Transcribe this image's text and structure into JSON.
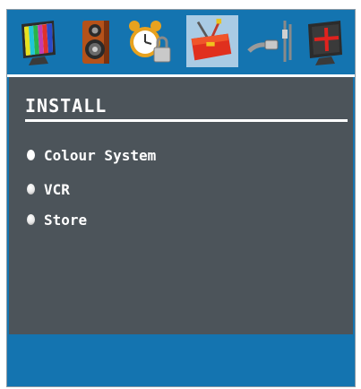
{
  "menu": {
    "title": "INSTALL",
    "items": [
      {
        "label": "Colour System",
        "active": true
      },
      {
        "label": "VCR",
        "active": false
      },
      {
        "label": "Store",
        "active": false
      }
    ]
  },
  "icons": [
    "picture-icon",
    "sound-icon",
    "timer-lock-icon",
    "install-toolbox-icon",
    "source-cable-icon",
    "feature-cross-icon"
  ],
  "colors": {
    "frame_blue": "#1474b0",
    "panel_gray": "#4c545a",
    "selected_tab": "#a9cbe4",
    "text": "#ffffff"
  }
}
